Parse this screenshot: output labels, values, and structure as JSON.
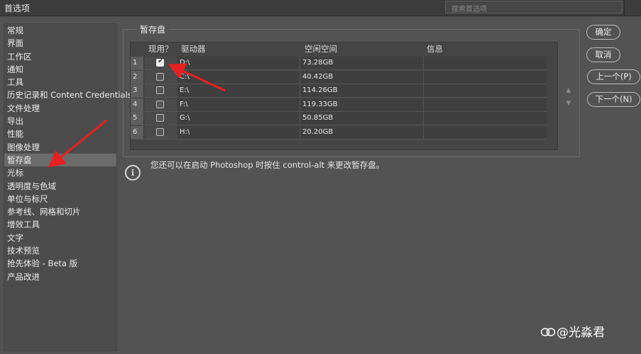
{
  "window": {
    "title": "首选项",
    "search_placeholder": "搜索首选项"
  },
  "sidebar": {
    "items": [
      {
        "label": "常规"
      },
      {
        "label": "界面"
      },
      {
        "label": "工作区"
      },
      {
        "label": "通知"
      },
      {
        "label": "工具"
      },
      {
        "label": "历史记录和 Content Credentials"
      },
      {
        "label": "文件处理"
      },
      {
        "label": "导出"
      },
      {
        "label": "性能"
      },
      {
        "label": "图像处理"
      },
      {
        "label": "暂存盘",
        "selected": true
      },
      {
        "label": "光标"
      },
      {
        "label": "透明度与色域"
      },
      {
        "label": "单位与标尺"
      },
      {
        "label": "参考线、网格和切片"
      },
      {
        "label": "增效工具"
      },
      {
        "label": "文字"
      },
      {
        "label": "技术预览"
      },
      {
        "label": "抢先体验 - Beta 版"
      },
      {
        "label": "产品改进"
      }
    ]
  },
  "scratch": {
    "group_title": "暂存盘",
    "headers": {
      "active": "现用？",
      "drive": "驱动器",
      "space": "空闲空间",
      "info": "信息"
    },
    "rows": [
      {
        "num": "1",
        "active": true,
        "drive": "D:\\",
        "space": "73.28GB",
        "info": ""
      },
      {
        "num": "2",
        "active": false,
        "drive": "C:\\",
        "space": "40.42GB",
        "info": ""
      },
      {
        "num": "3",
        "active": false,
        "drive": "E:\\",
        "space": "114.26GB",
        "info": ""
      },
      {
        "num": "4",
        "active": false,
        "drive": "F:\\",
        "space": "119.33GB",
        "info": ""
      },
      {
        "num": "5",
        "active": false,
        "drive": "G:\\",
        "space": "50.85GB",
        "info": ""
      },
      {
        "num": "6",
        "active": false,
        "drive": "H:\\",
        "space": "20.20GB",
        "info": ""
      }
    ],
    "scroll_up": "▲",
    "scroll_down": "▼"
  },
  "info": {
    "icon": "info-circle-icon",
    "text": "您还可以在启动 Photoshop 时按住 control-alt 来更改暂存盘。"
  },
  "buttons": {
    "ok": "确定",
    "cancel": "取消",
    "prev": "上一个(P)",
    "next": "下一个(N)"
  },
  "watermark": {
    "text": "@光淼君",
    "icon": "toutiao-logo-icon"
  },
  "annotations": {
    "color": "#e8201f"
  }
}
